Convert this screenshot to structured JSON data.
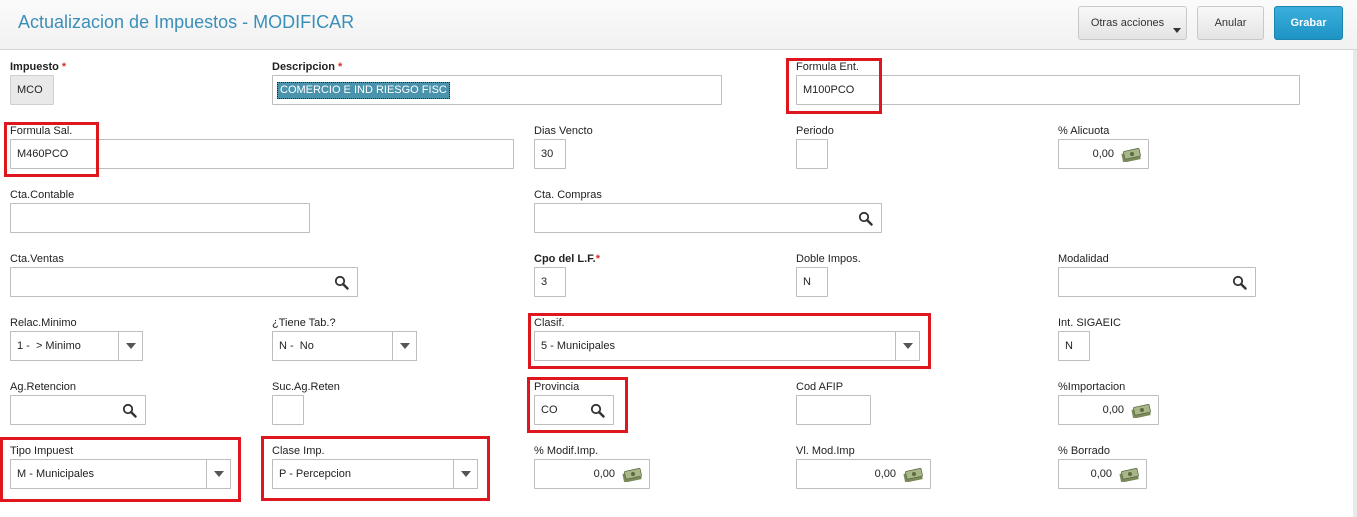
{
  "header": {
    "title": "Actualizacion de Impuestos - MODIFICAR",
    "buttons": {
      "otras": "Otras acciones",
      "anular": "Anular",
      "grabar": "Grabar"
    }
  },
  "fields": {
    "impuesto": {
      "label": "Impuesto",
      "value": "MCO",
      "required": "*"
    },
    "descripcion": {
      "label": "Descripcion",
      "value": "COMERCIO E IND RIESGO FISC",
      "required": "*"
    },
    "formula_ent": {
      "label": "Formula Ent.",
      "value": "M100PCO"
    },
    "formula_sal": {
      "label": "Formula Sal.",
      "value": "M460PCO"
    },
    "dias_vencto": {
      "label": "Dias Vencto",
      "value": "30"
    },
    "periodo": {
      "label": "Periodo",
      "value": ""
    },
    "alicuota": {
      "label": "% Alicuota",
      "value": "0,00"
    },
    "cta_contable": {
      "label": "Cta.Contable",
      "value": ""
    },
    "cta_compras": {
      "label": "Cta. Compras",
      "value": ""
    },
    "cta_ventas": {
      "label": "Cta.Ventas",
      "value": ""
    },
    "cpo_lf": {
      "label": "Cpo del L.F.",
      "value": "3",
      "required": "*"
    },
    "doble_impos": {
      "label": "Doble Impos.",
      "value": "N"
    },
    "modalidad": {
      "label": "Modalidad",
      "value": ""
    },
    "relac_minimo": {
      "label": "Relac.Minimo",
      "value": "1 -  > Minimo"
    },
    "tiene_tab": {
      "label": "¿Tiene Tab.?",
      "value": "N -  No"
    },
    "clasif": {
      "label": "Clasif.",
      "value": "5 - Municipales"
    },
    "int_sigaeic": {
      "label": "Int. SIGAEIC",
      "value": "N"
    },
    "ag_retencion": {
      "label": "Ag.Retencion",
      "value": ""
    },
    "suc_ag_reten": {
      "label": "Suc.Ag.Reten",
      "value": ""
    },
    "provincia": {
      "label": "Provincia",
      "value": "CO"
    },
    "cod_afip": {
      "label": "Cod AFIP",
      "value": ""
    },
    "importacion": {
      "label": "%Importacion",
      "value": "0,00"
    },
    "tipo_impuest": {
      "label": "Tipo Impuest",
      "value": "M - Municipales"
    },
    "clase_imp": {
      "label": "Clase Imp.",
      "value": "P - Percepcion"
    },
    "modif_imp": {
      "label": "% Modif.Imp.",
      "value": "0,00"
    },
    "vl_mod_imp": {
      "label": "Vl. Mod.Imp",
      "value": "0,00"
    },
    "borrado": {
      "label": "% Borrado",
      "value": "0,00"
    }
  },
  "colors": {
    "title": "#3a8fb8",
    "primary_button": "#1f93c4",
    "required": "#d9302c",
    "highlight": "#e0161e"
  }
}
